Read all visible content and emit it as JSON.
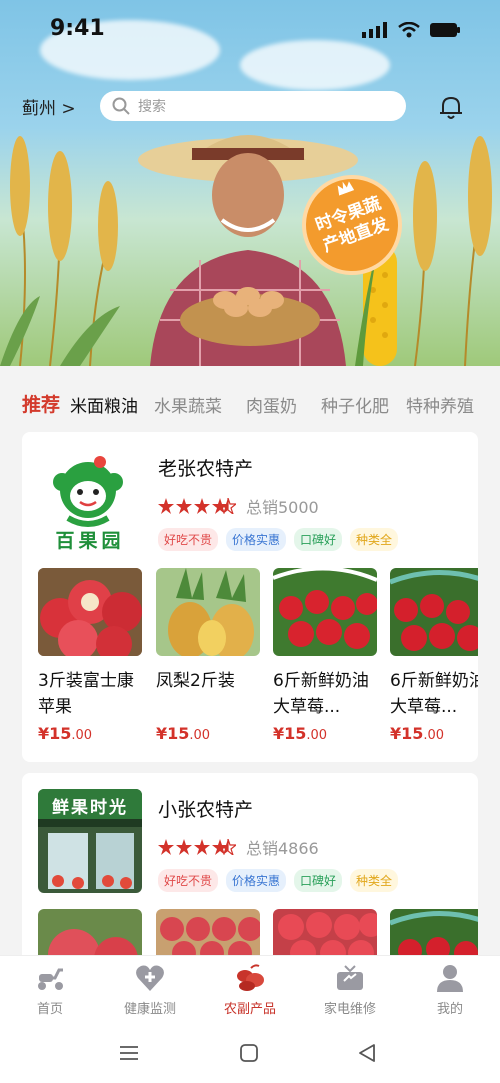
{
  "status": {
    "time": "9:41"
  },
  "header": {
    "city": "蓟州 >",
    "search_placeholder": "搜索"
  },
  "banner": {
    "promo_line1": "时令果蔬",
    "promo_line2": "产地直发"
  },
  "tabs": [
    {
      "label": "推荐",
      "state": "active"
    },
    {
      "label": "米面粮油"
    },
    {
      "label": "水果蔬菜"
    },
    {
      "label": "肉蛋奶"
    },
    {
      "label": "种子化肥"
    },
    {
      "label": "特种养殖"
    }
  ],
  "stores": [
    {
      "name": "老张农特产",
      "rating": 4.5,
      "sales": "总销5000",
      "logo_text": "百果园",
      "badges": [
        "好吃不贵",
        "价格实惠",
        "口碑好",
        "种类全"
      ],
      "products": [
        {
          "name": "3斤装富士康苹果",
          "price": "¥15.00",
          "image": "apple"
        },
        {
          "name": "凤梨2斤装",
          "price": "¥15.00",
          "image": "pineapple"
        },
        {
          "name": "6斤新鲜奶油大草莓...",
          "price": "¥15.00",
          "image": "strawberry"
        },
        {
          "name": "6斤新鲜奶油大草莓...",
          "price": "¥15.00",
          "image": "strawberry-box"
        }
      ]
    },
    {
      "name": "小张农特产",
      "rating": 4.5,
      "sales": "总销4866",
      "logo_text": "鲜果时光",
      "badges": [
        "好吃不贵",
        "价格实惠",
        "口碑好",
        "种类全"
      ],
      "products": [
        {
          "image": "apple"
        },
        {
          "image": "apples-box"
        },
        {
          "image": "strawberry"
        },
        {
          "image": "strawberry-box"
        }
      ]
    }
  ],
  "bottom_nav": [
    {
      "label": "首页",
      "icon": "scooter-icon"
    },
    {
      "label": "健康监测",
      "icon": "heart-plus-icon"
    },
    {
      "label": "农副产品",
      "icon": "produce-icon",
      "state": "active"
    },
    {
      "label": "家电维修",
      "icon": "tv-repair-icon"
    },
    {
      "label": "我的",
      "icon": "user-icon"
    }
  ],
  "colors": {
    "accent": "#d33a2c",
    "star": "#d3322a",
    "promo": "#f39b2d"
  }
}
